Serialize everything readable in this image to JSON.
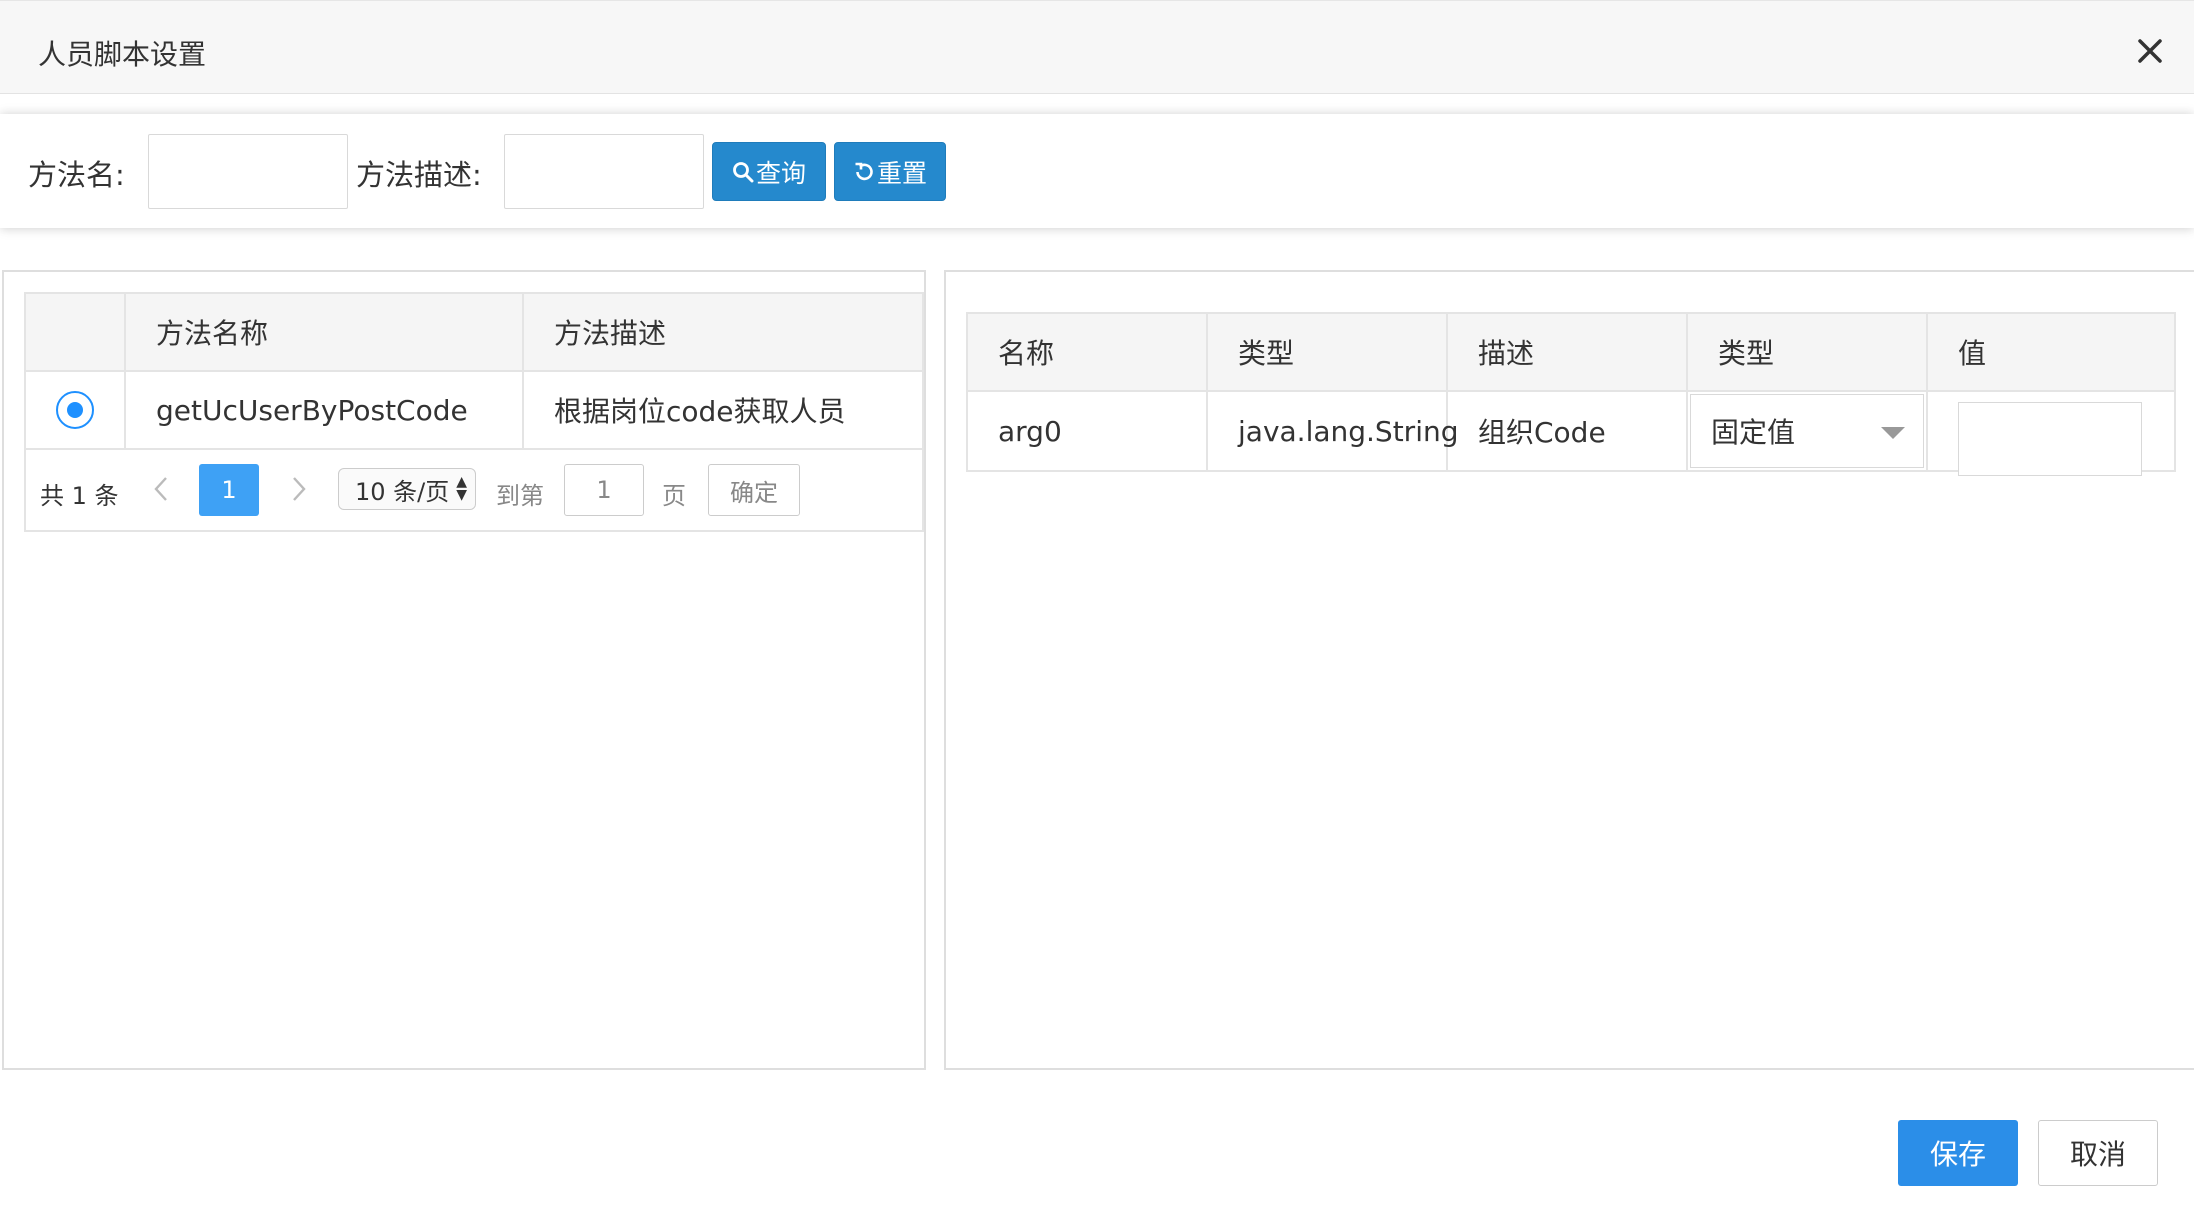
{
  "dialog": {
    "title": "人员脚本设置"
  },
  "search": {
    "method_name_label": "方法名:",
    "method_desc_label": "方法描述:",
    "method_name_value": "",
    "method_desc_value": "",
    "query_label": "查询",
    "reset_label": "重置"
  },
  "left_table": {
    "headers": [
      "",
      "方法名称",
      "方法描述"
    ],
    "rows": [
      {
        "selected": true,
        "name": "getUcUserByPostCode",
        "desc": "根据岗位code获取人员"
      }
    ],
    "pager": {
      "total": "共 1 条",
      "current_page": "1",
      "page_size": "10 条/页",
      "goto_label": "到第",
      "goto_value": "1",
      "page_label": "页",
      "confirm_label": "确定"
    }
  },
  "right_table": {
    "headers": [
      "名称",
      "类型",
      "描述",
      "类型",
      "值"
    ],
    "rows": [
      {
        "name": "arg0",
        "type": "java.lang.String",
        "desc": "组织Code",
        "value_type": "固定值",
        "value": ""
      }
    ]
  },
  "footer": {
    "save_label": "保存",
    "cancel_label": "取消"
  },
  "colors": {
    "primary": "#2589cd",
    "pager_active": "#3ea1f5",
    "save": "#2b8ee8"
  },
  "icons": [
    "close-icon",
    "search-icon",
    "refresh-icon",
    "chevron-left-icon",
    "chevron-right-icon",
    "caret-down-icon"
  ]
}
